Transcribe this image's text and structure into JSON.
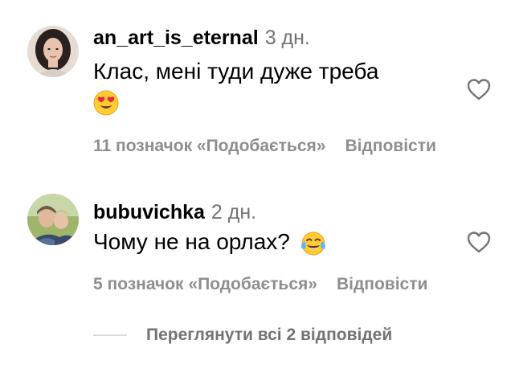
{
  "comments": [
    {
      "username": "an_art_is_eternal",
      "time": "3 дн.",
      "text": "Клас, мені туди дуже треба",
      "emoji": "heart-eyes-emoji",
      "likes": "11 позначок «Подобається»",
      "reply": "Відповісти"
    },
    {
      "username": "bubuvichka",
      "time": "2 дн.",
      "text": "Чому не на орлах?",
      "emoji": "tears-of-joy-emoji",
      "likes": "5 позначок «Подобається»",
      "reply": "Відповісти"
    }
  ],
  "view_replies": "Переглянути всі 2 відповідей",
  "icons": {
    "like": "heart-outline-icon"
  },
  "colors": {
    "text": "#000000",
    "secondary": "#8e8e8e",
    "divider": "#dbdbdb"
  }
}
